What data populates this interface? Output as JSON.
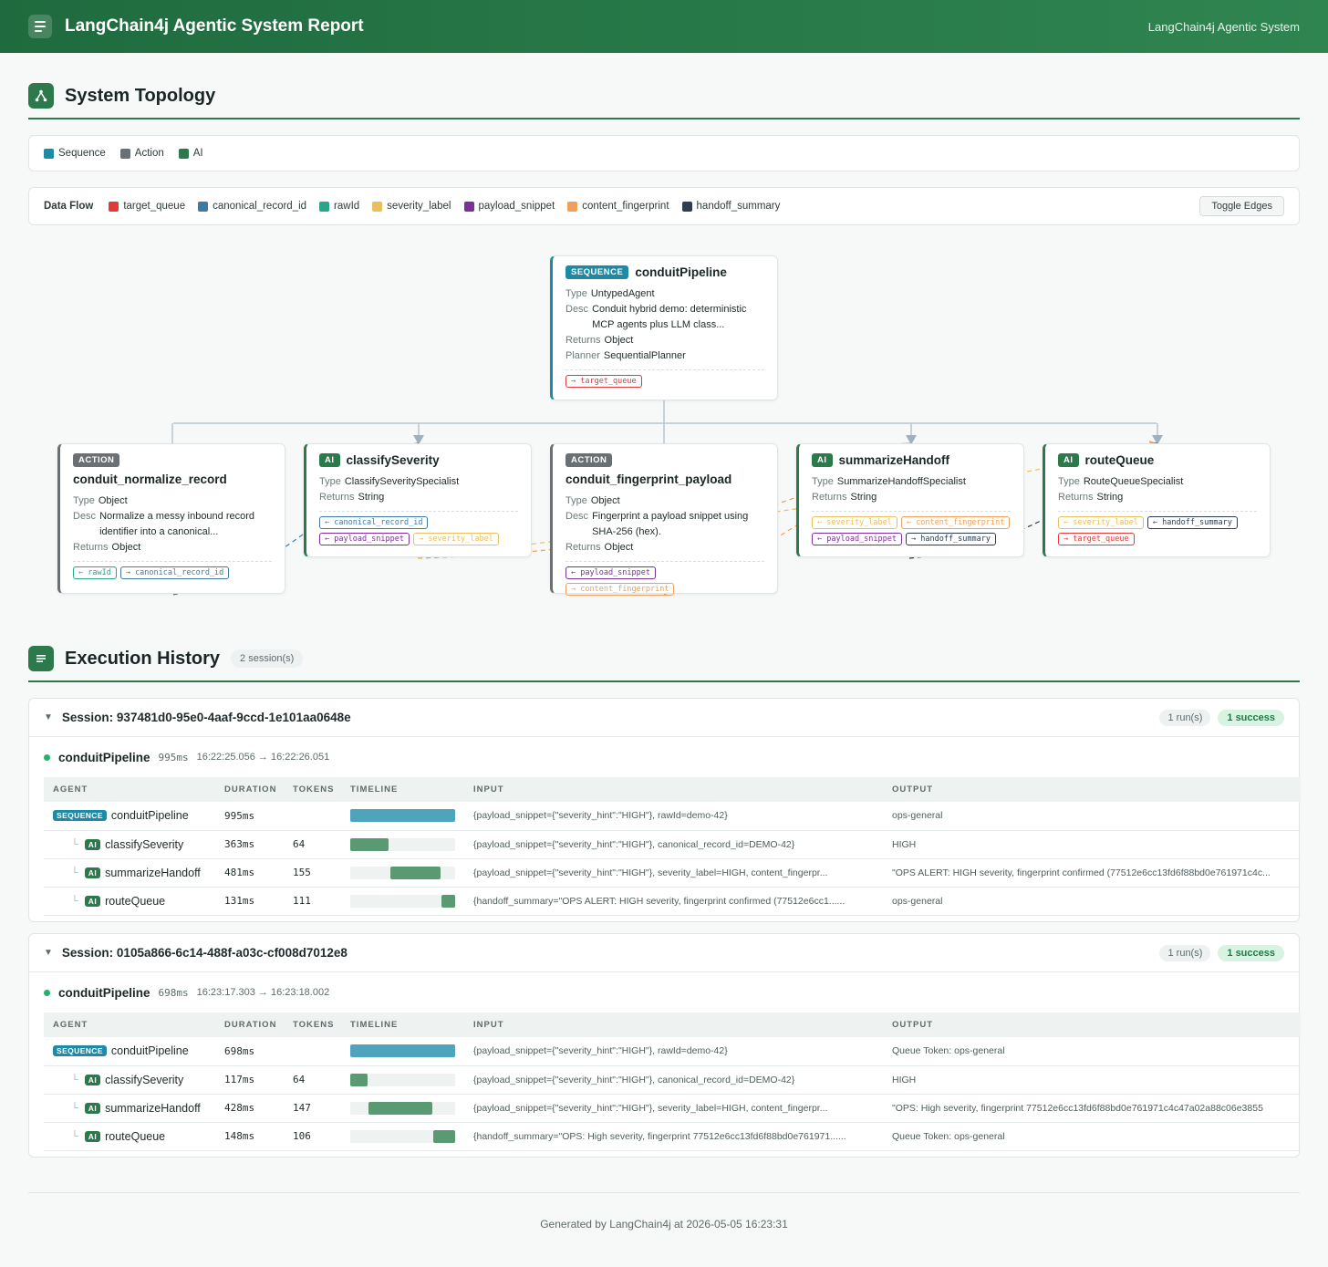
{
  "header": {
    "title": "LangChain4j Agentic System Report",
    "subtitle": "LangChain4j Agentic System"
  },
  "topology": {
    "title": "System Topology",
    "legend": [
      {
        "label": "Sequence",
        "color": "#1f8aa6"
      },
      {
        "label": "Action",
        "color": "#6a7176"
      },
      {
        "label": "AI",
        "color": "#2c7a4b"
      }
    ],
    "dataflow_title": "Data Flow",
    "dataflow": [
      {
        "label": "target_queue",
        "color": "#e03b3b"
      },
      {
        "label": "canonical_record_id",
        "color": "#3f7aa6"
      },
      {
        "label": "rawId",
        "color": "#2aa58a"
      },
      {
        "label": "severity_label",
        "color": "#e8c060"
      },
      {
        "label": "payload_snippet",
        "color": "#7b2f9a"
      },
      {
        "label": "content_fingerprint",
        "color": "#f0a05a"
      },
      {
        "label": "handoff_summary",
        "color": "#2c3e50"
      }
    ],
    "toggle_label": "Toggle Edges",
    "root": {
      "badge": "SEQUENCE",
      "name": "conduitPipeline",
      "fields": [
        {
          "k": "Type",
          "v": "UntypedAgent"
        },
        {
          "k": "Desc",
          "v": "Conduit hybrid demo: deterministic MCP agents plus LLM class..."
        },
        {
          "k": "Returns",
          "v": "Object"
        },
        {
          "k": "Planner",
          "v": "SequentialPlanner"
        }
      ],
      "chips": [
        {
          "label": "→ target_queue",
          "color": "#e03b3b"
        }
      ]
    },
    "children": [
      {
        "kind": "act",
        "badge": "ACTION",
        "name": "conduit_normalize_record",
        "fields": [
          {
            "k": "Type",
            "v": "Object"
          },
          {
            "k": "Desc",
            "v": "Normalize a messy inbound record identifier into a canonical..."
          },
          {
            "k": "Returns",
            "v": "Object"
          }
        ],
        "chips": [
          {
            "label": "← rawId",
            "color": "#2aa58a"
          },
          {
            "label": "→ canonical_record_id",
            "color": "#3f7aa6"
          }
        ]
      },
      {
        "kind": "ai",
        "badge": "AI",
        "name": "classifySeverity",
        "fields": [
          {
            "k": "Type",
            "v": "ClassifySeveritySpecialist"
          },
          {
            "k": "Returns",
            "v": "String"
          }
        ],
        "chips": [
          {
            "label": "← canonical_record_id",
            "color": "#3f7aa6"
          },
          {
            "label": "← payload_snippet",
            "color": "#7b2f9a"
          },
          {
            "label": "→ severity_label",
            "color": "#e8c060"
          }
        ]
      },
      {
        "kind": "act",
        "badge": "ACTION",
        "name": "conduit_fingerprint_payload",
        "fields": [
          {
            "k": "Type",
            "v": "Object"
          },
          {
            "k": "Desc",
            "v": "Fingerprint a payload snippet using SHA-256 (hex)."
          },
          {
            "k": "Returns",
            "v": "Object"
          }
        ],
        "chips": [
          {
            "label": "← payload_snippet",
            "color": "#7b2f9a"
          },
          {
            "label": "→ content_fingerprint",
            "color": "#f0a05a"
          }
        ]
      },
      {
        "kind": "ai",
        "badge": "AI",
        "name": "summarizeHandoff",
        "fields": [
          {
            "k": "Type",
            "v": "SummarizeHandoffSpecialist"
          },
          {
            "k": "Returns",
            "v": "String"
          }
        ],
        "chips": [
          {
            "label": "← severity_label",
            "color": "#e8c060"
          },
          {
            "label": "← content_fingerprint",
            "color": "#f0a05a"
          },
          {
            "label": "← payload_snippet",
            "color": "#7b2f9a"
          },
          {
            "label": "→ handoff_summary",
            "color": "#2c3e50"
          }
        ]
      },
      {
        "kind": "ai",
        "badge": "AI",
        "name": "routeQueue",
        "fields": [
          {
            "k": "Type",
            "v": "RouteQueueSpecialist"
          },
          {
            "k": "Returns",
            "v": "String"
          }
        ],
        "chips": [
          {
            "label": "← severity_label",
            "color": "#e8c060"
          },
          {
            "label": "← handoff_summary",
            "color": "#2c3e50"
          },
          {
            "label": "→ target_queue",
            "color": "#e03b3b"
          }
        ]
      }
    ]
  },
  "history": {
    "title": "Execution History",
    "session_count": "2 session(s)",
    "columns": [
      "AGENT",
      "DURATION",
      "TOKENS",
      "TIMELINE",
      "INPUT",
      "OUTPUT"
    ],
    "sessions": [
      {
        "title": "Session: 937481d0-95e0-4aaf-9ccd-1e101aa0648e",
        "runs": "1 run(s)",
        "status": "1 success",
        "run": {
          "name": "conduitPipeline",
          "duration": "995ms",
          "span": "16:22:25.056 → 16:22:26.051"
        },
        "rows": [
          {
            "badge": "SEQUENCE",
            "kind": "seq",
            "name": "conduitPipeline",
            "child": false,
            "duration": "995ms",
            "tokens": "",
            "start": 0,
            "width": 1,
            "input": "{payload_snippet={\"severity_hint\":\"HIGH\"}, rawId=demo-42}",
            "output": "ops-general"
          },
          {
            "badge": "AI",
            "kind": "ai",
            "name": "classifySeverity",
            "child": true,
            "duration": "363ms",
            "tokens": "64",
            "start": 0,
            "width": 0.365,
            "input": "{payload_snippet={\"severity_hint\":\"HIGH\"}, canonical_record_id=DEMO-42}",
            "output": "HIGH"
          },
          {
            "badge": "AI",
            "kind": "ai",
            "name": "summarizeHandoff",
            "child": true,
            "duration": "481ms",
            "tokens": "155",
            "start": 0.38,
            "width": 0.483,
            "input": "{payload_snippet={\"severity_hint\":\"HIGH\"}, severity_label=HIGH, content_fingerpr...",
            "output": "\"OPS ALERT: HIGH severity, fingerprint confirmed (77512e6cc13fd6f88bd0e761971c4c..."
          },
          {
            "badge": "AI",
            "kind": "ai",
            "name": "routeQueue",
            "child": true,
            "duration": "131ms",
            "tokens": "111",
            "start": 0.868,
            "width": 0.132,
            "input": "{handoff_summary=\"OPS ALERT: HIGH severity, fingerprint confirmed (77512e6cc1......",
            "output": "ops-general"
          }
        ]
      },
      {
        "title": "Session: 0105a866-6c14-488f-a03c-cf008d7012e8",
        "runs": "1 run(s)",
        "status": "1 success",
        "run": {
          "name": "conduitPipeline",
          "duration": "698ms",
          "span": "16:23:17.303 → 16:23:18.002"
        },
        "rows": [
          {
            "badge": "SEQUENCE",
            "kind": "seq",
            "name": "conduitPipeline",
            "child": false,
            "duration": "698ms",
            "tokens": "",
            "start": 0,
            "width": 1,
            "input": "{payload_snippet={\"severity_hint\":\"HIGH\"}, rawId=demo-42}",
            "output": "Queue Token: ops-general"
          },
          {
            "badge": "AI",
            "kind": "ai",
            "name": "classifySeverity",
            "child": true,
            "duration": "117ms",
            "tokens": "64",
            "start": 0,
            "width": 0.168,
            "input": "{payload_snippet={\"severity_hint\":\"HIGH\"}, canonical_record_id=DEMO-42}",
            "output": "HIGH"
          },
          {
            "badge": "AI",
            "kind": "ai",
            "name": "summarizeHandoff",
            "child": true,
            "duration": "428ms",
            "tokens": "147",
            "start": 0.17,
            "width": 0.613,
            "input": "{payload_snippet={\"severity_hint\":\"HIGH\"}, severity_label=HIGH, content_fingerpr...",
            "output": "\"OPS: High severity, fingerprint 77512e6cc13fd6f88bd0e761971c4c47a02a88c06e3855"
          },
          {
            "badge": "AI",
            "kind": "ai",
            "name": "routeQueue",
            "child": true,
            "duration": "148ms",
            "tokens": "106",
            "start": 0.788,
            "width": 0.212,
            "input": "{handoff_summary=\"OPS: High severity, fingerprint 77512e6cc13fd6f88bd0e761971......",
            "output": "Queue Token: ops-general"
          }
        ]
      }
    ]
  },
  "footer": "Generated by LangChain4j at 2026-05-05 16:23:31"
}
